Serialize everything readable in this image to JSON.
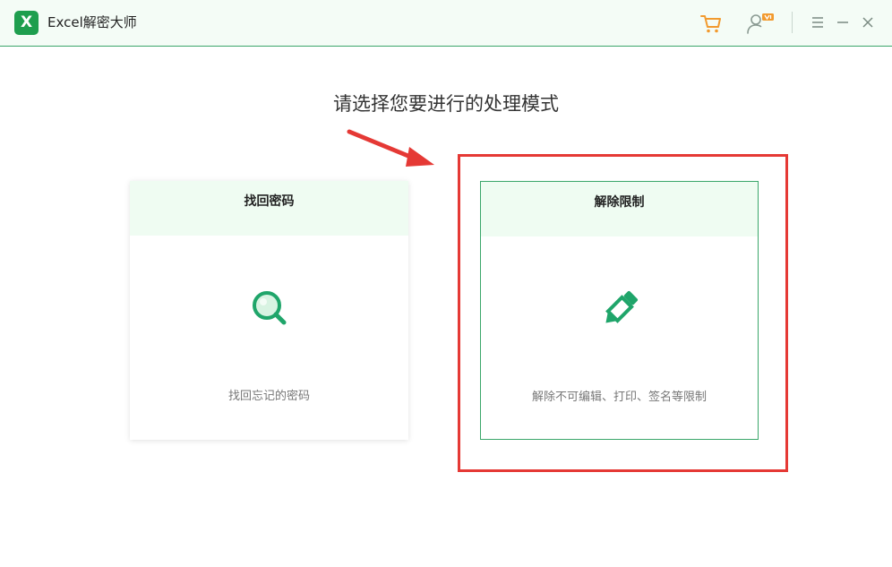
{
  "app": {
    "title": "Excel解密大师",
    "logo_letter": "X"
  },
  "main": {
    "heading": "请选择您要进行的处理模式"
  },
  "cards": [
    {
      "title": "找回密码",
      "description": "找回忘记的密码",
      "icon": "magnifier-icon"
    },
    {
      "title": "解除限制",
      "description": "解除不可编辑、打印、签名等限制",
      "icon": "pencil-icon"
    }
  ],
  "titlebar_icons": [
    "cart-icon",
    "user-vip-icon",
    "menu-icon",
    "minimize-icon",
    "close-icon"
  ],
  "colors": {
    "brand": "#1e9e4e",
    "header_bg": "#f4fcf6",
    "card_head_bg": "#effcf2",
    "highlight": "#e53935",
    "vip_badge": "#f29a2e"
  }
}
